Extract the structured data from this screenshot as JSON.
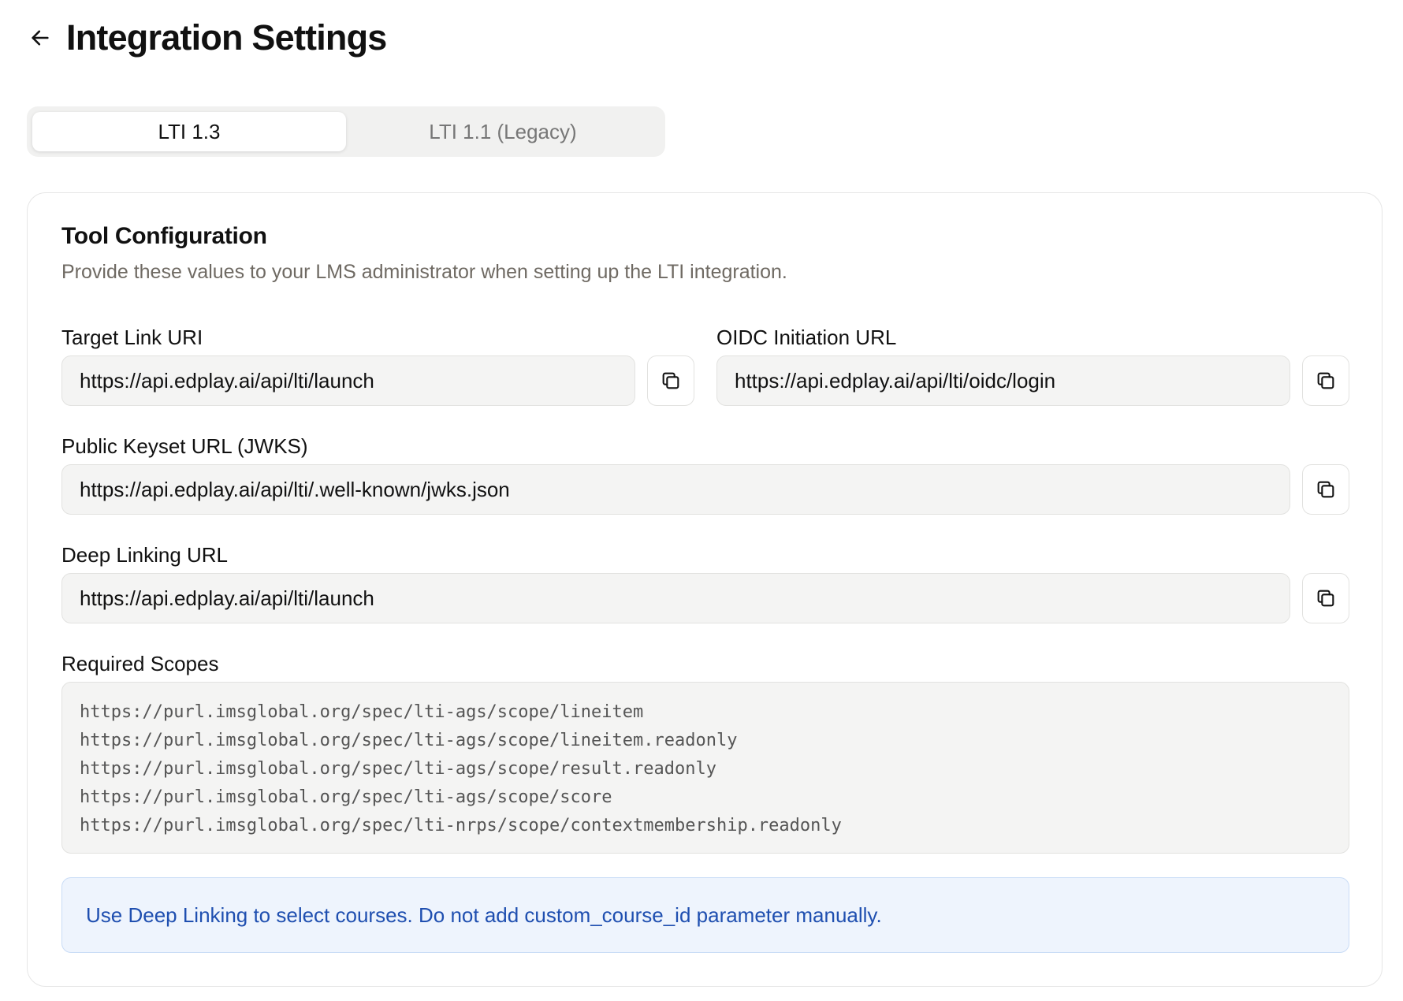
{
  "header": {
    "title": "Integration Settings",
    "back_icon": "arrow-left-icon"
  },
  "tabs": [
    {
      "label": "LTI 1.3",
      "active": true
    },
    {
      "label": "LTI 1.1 (Legacy)",
      "active": false
    }
  ],
  "tool_config": {
    "title": "Tool Configuration",
    "description": "Provide these values to your LMS administrator when setting up the LTI integration.",
    "fields": {
      "target_link": {
        "label": "Target Link URI",
        "value": "https://api.edplay.ai/api/lti/launch"
      },
      "oidc": {
        "label": "OIDC Initiation URL",
        "value": "https://api.edplay.ai/api/lti/oidc/login"
      },
      "jwks": {
        "label": "Public Keyset URL (JWKS)",
        "value": "https://api.edplay.ai/api/lti/.well-known/jwks.json"
      },
      "deep_linking": {
        "label": "Deep Linking URL",
        "value": "https://api.edplay.ai/api/lti/launch"
      }
    },
    "scopes": {
      "label": "Required Scopes",
      "items": [
        "https://purl.imsglobal.org/spec/lti-ags/scope/lineitem",
        "https://purl.imsglobal.org/spec/lti-ags/scope/lineitem.readonly",
        "https://purl.imsglobal.org/spec/lti-ags/scope/result.readonly",
        "https://purl.imsglobal.org/spec/lti-ags/scope/score",
        "https://purl.imsglobal.org/spec/lti-nrps/scope/contextmembership.readonly"
      ]
    },
    "notice": "Use Deep Linking to select courses. Do not add custom_course_id parameter manually."
  },
  "colors": {
    "notice_text": "#1f4fb0",
    "notice_bg": "#eef4fd",
    "field_bg": "#f4f4f3"
  }
}
